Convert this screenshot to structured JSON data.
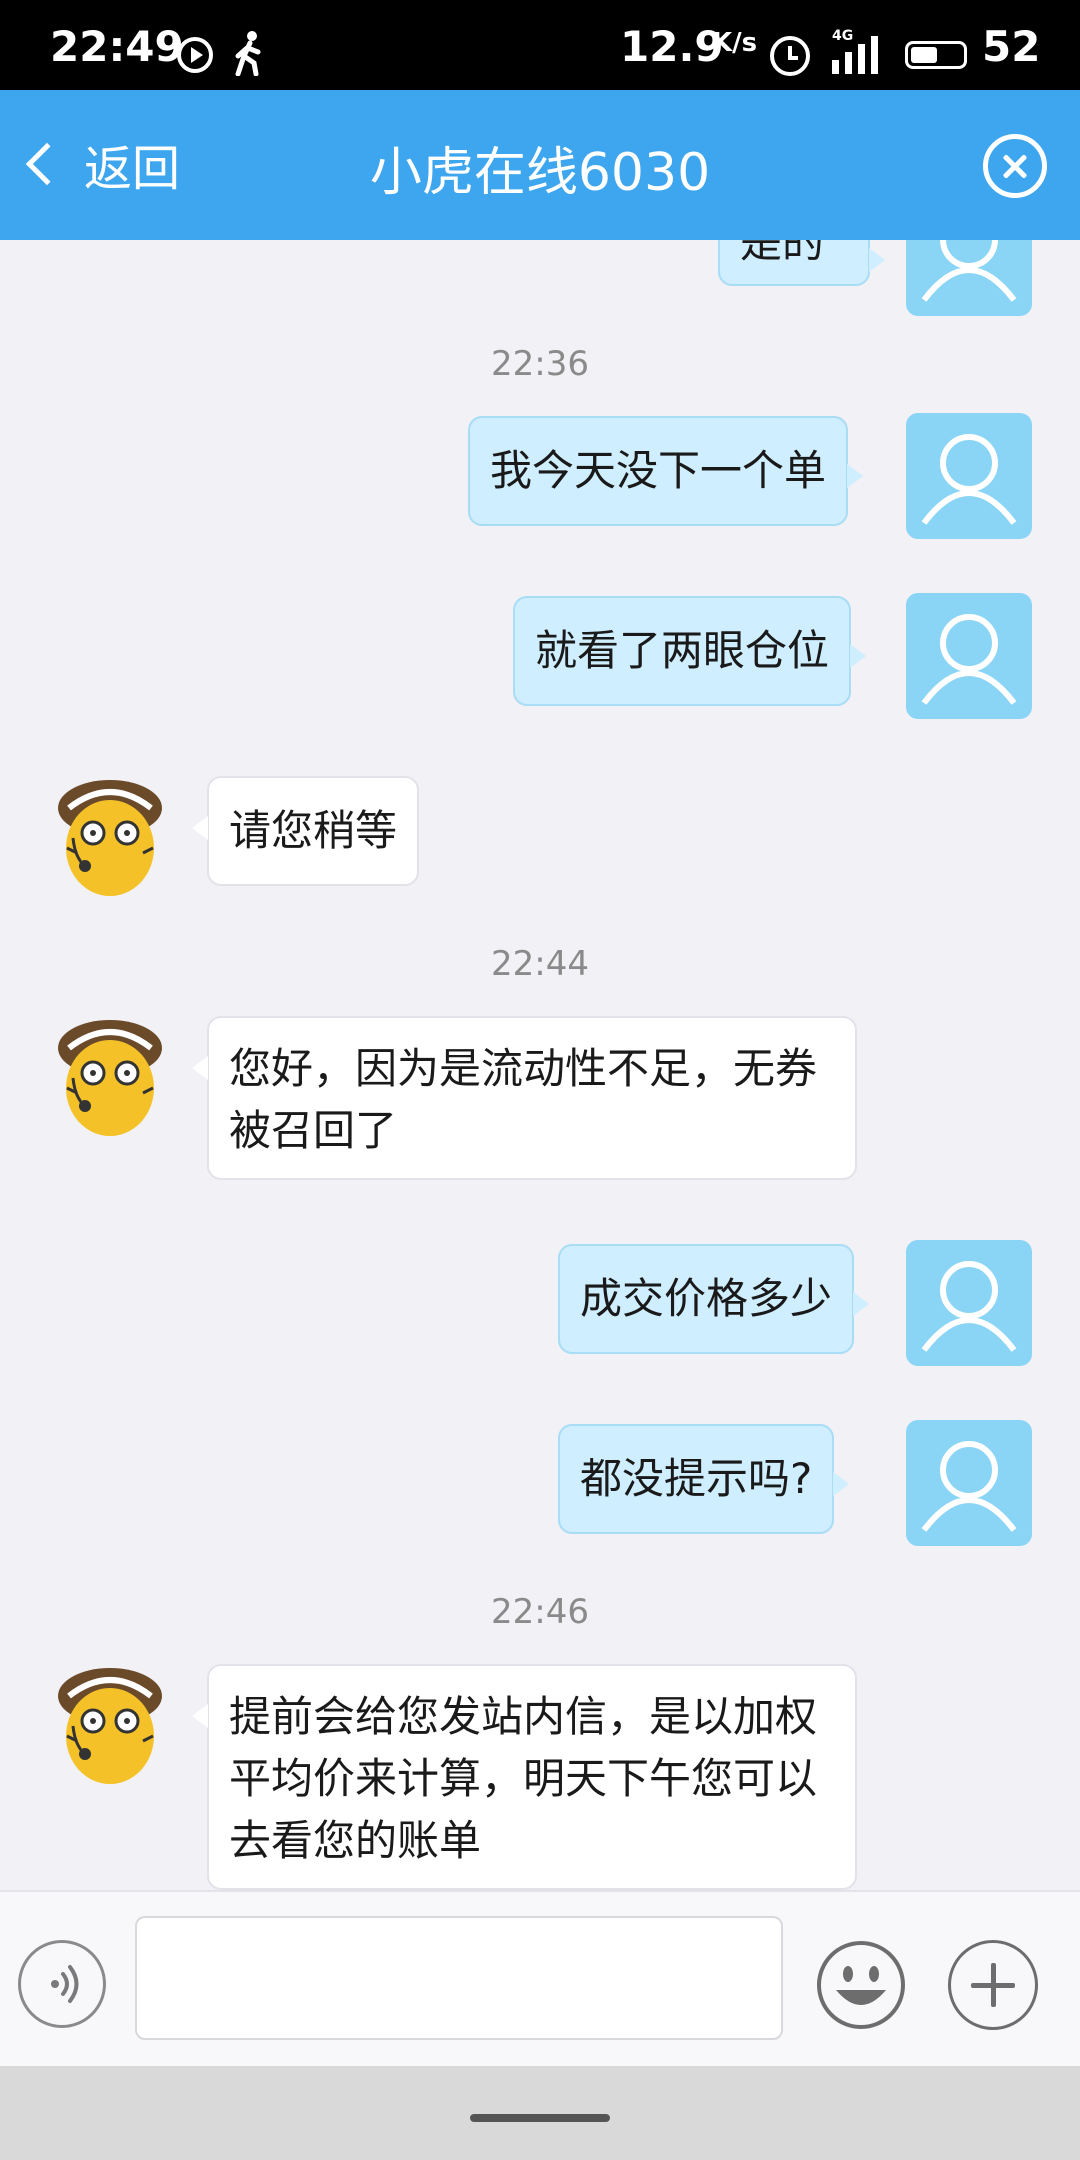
{
  "status_bar": {
    "time": "22:49",
    "net_speed": "12.9",
    "net_unit": "K/s",
    "network_type": "4G",
    "battery_level": "52",
    "battery_fraction": 0.52,
    "icons": [
      "play-icon",
      "walk-icon",
      "alarm-icon",
      "signal-icon",
      "battery-icon"
    ]
  },
  "header": {
    "back_label": "返回",
    "title": "小虎在线6030",
    "close_icon": "close-circle-icon"
  },
  "messages": {
    "partial_text": "是的",
    "ts1": "22:36",
    "m1": "我今天没下一个单",
    "m2": "就看了两眼仓位",
    "m3": "请您稍等",
    "ts2": "22:44",
    "m4": "您好，因为是流动性不足，无券被召回了",
    "m5": "成交价格多少",
    "m6": "都没提示吗?",
    "ts3": "22:46",
    "m7": "提前会给您发站内信，是以加权平均价来计算，明天下午您可以去看您的账单"
  },
  "input_bar": {
    "voice_icon": "voice-icon",
    "text_value": "",
    "emoji_icon": "emoji-icon",
    "plus_icon": "plus-icon"
  },
  "colors": {
    "header_bg": "#3ea6ee",
    "my_bubble": "#cfeeff",
    "their_bubble": "#ffffff",
    "user_avatar_bg": "#8ad5f6",
    "chat_bg": "#f1f1f6"
  }
}
